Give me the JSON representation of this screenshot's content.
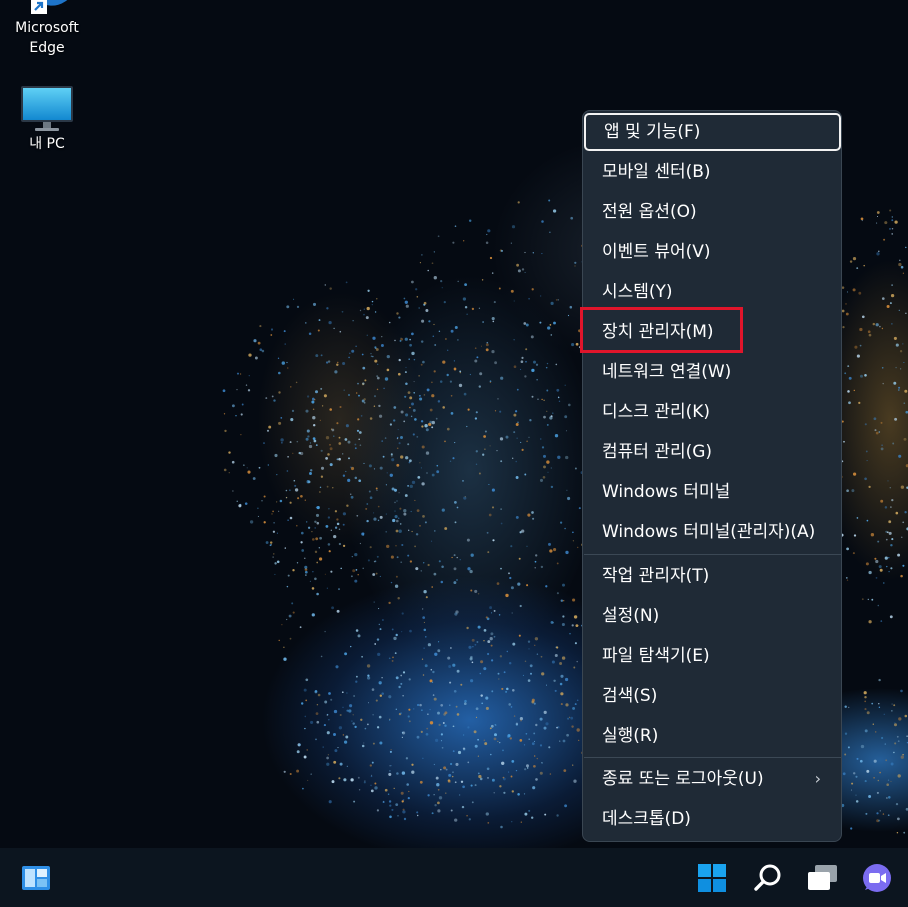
{
  "desktop": {
    "icons": [
      {
        "label": "Microsoft\nEdge",
        "icon": "edge-icon"
      },
      {
        "label": "내 PC",
        "icon": "computer-icon"
      }
    ]
  },
  "context_menu": {
    "items": [
      {
        "label": "앱 및 기능(F)",
        "focused": true
      },
      {
        "label": "모바일 센터(B)"
      },
      {
        "label": "전원 옵션(O)"
      },
      {
        "label": "이벤트 뷰어(V)"
      },
      {
        "label": "시스템(Y)"
      },
      {
        "label": "장치 관리자(M)",
        "highlighted": true
      },
      {
        "label": "네트워크 연결(W)"
      },
      {
        "label": "디스크 관리(K)"
      },
      {
        "label": "컴퓨터 관리(G)"
      },
      {
        "label": "Windows 터미널"
      },
      {
        "label": "Windows 터미널(관리자)(A)"
      },
      {
        "label": "작업 관리자(T)"
      },
      {
        "label": "설정(N)"
      },
      {
        "label": "파일 탐색기(E)"
      },
      {
        "label": "검색(S)"
      },
      {
        "label": "실행(R)"
      },
      {
        "label": "종료 또는 로그아웃(U)",
        "submenu": true
      },
      {
        "label": "데스크톱(D)"
      }
    ],
    "submenu_arrow": "›",
    "highlight_color": "#e0152b"
  },
  "taskbar": {
    "left_icons": [
      "widgets-icon"
    ],
    "center_icons": [
      "start-icon",
      "search-icon",
      "task-view-icon",
      "chat-icon"
    ]
  },
  "colors": {
    "menu_background": "#1f2a36",
    "taskbar_background": "#0c151f",
    "accent_blue": "#0f8fe0"
  }
}
